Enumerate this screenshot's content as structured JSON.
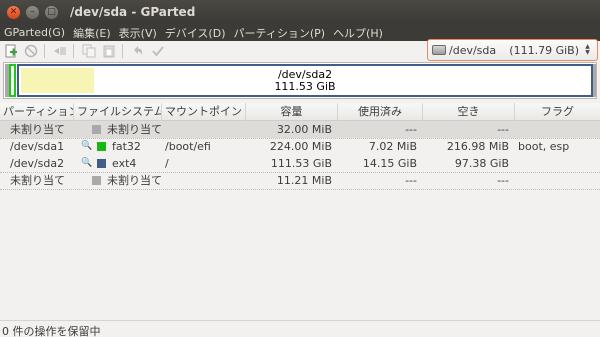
{
  "window": {
    "title": "/dev/sda - GParted",
    "close_glyph": "✕",
    "minimize_glyph": "–",
    "maximize_glyph": "□"
  },
  "menu": [
    "GParted(G)",
    "編集(E)",
    "表示(V)",
    "デバイス(D)",
    "パーティション(P)",
    "ヘルプ(H)"
  ],
  "toolbar": {
    "icons": [
      "new-partition-icon",
      "delete-partition-icon",
      "resize-move-icon",
      "copy-icon",
      "paste-icon",
      "undo-icon",
      "apply-icon"
    ]
  },
  "device": {
    "name": "/dev/sda",
    "size": "(111.79 GiB)",
    "icon": "disk-icon"
  },
  "diskmap": {
    "partition_name": "/dev/sda2",
    "partition_size": "111.53 GiB",
    "used_fraction": 0.127
  },
  "table": {
    "headers": [
      "パーティション",
      "ファイルシステム",
      "マウントポイント",
      "容量",
      "使用済み",
      "空き",
      "フラグ"
    ],
    "rows": [
      {
        "partition": "未割り当て",
        "fs": "未割り当て",
        "fs_color": "#a9a9a9",
        "mount": "",
        "size": "32.00 MiB",
        "used": "---",
        "free": "---",
        "flags": "",
        "selected": true
      },
      {
        "partition": "/dev/sda1",
        "fs": "fat32",
        "fs_color": "#18b814",
        "mount": "/boot/efi",
        "size": "224.00 MiB",
        "used": "7.02 MiB",
        "free": "216.98 MiB",
        "flags": "boot, esp",
        "key": true
      },
      {
        "partition": "/dev/sda2",
        "fs": "ext4",
        "fs_color": "#3f5d88",
        "mount": "/",
        "size": "111.53 GiB",
        "used": "14.15 GiB",
        "free": "97.38 GiB",
        "flags": "",
        "key": true
      },
      {
        "partition": "未割り当て",
        "fs": "未割り当て",
        "fs_color": "#a9a9a9",
        "mount": "",
        "size": "11.21 MiB",
        "used": "---",
        "free": "---",
        "flags": ""
      }
    ]
  },
  "status": {
    "text": "0 件の操作を保留中"
  }
}
